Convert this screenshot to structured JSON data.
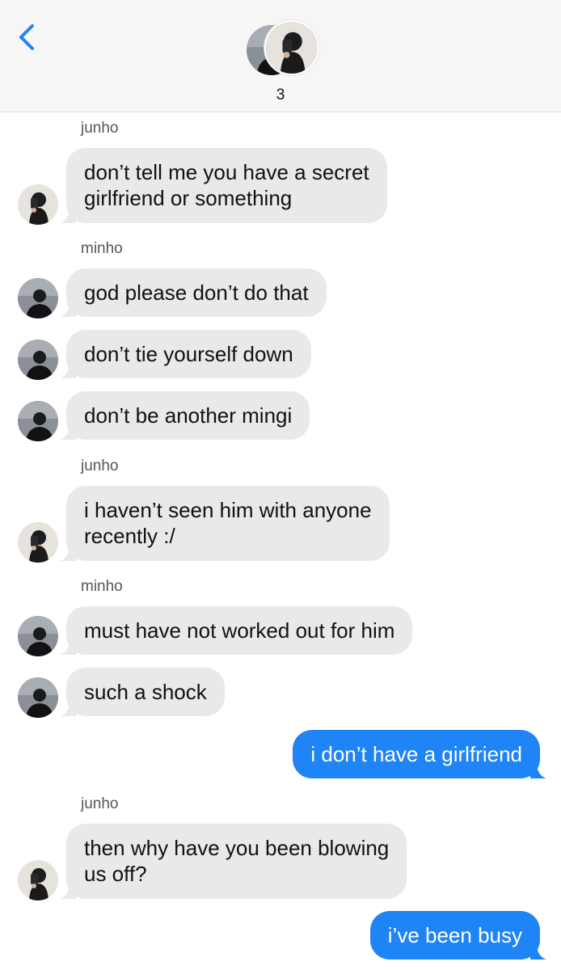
{
  "header": {
    "back_icon": "chevron-left-icon",
    "participant_count": "3",
    "accent": "#1f84f5"
  },
  "messages": [
    {
      "type": "sender",
      "text": "junho"
    },
    {
      "type": "in",
      "who": "junho",
      "text": [
        "don’t tell me you have a secret",
        "girlfriend or something"
      ]
    },
    {
      "type": "sender",
      "text": "minho"
    },
    {
      "type": "in",
      "who": "minho",
      "text": [
        "god please don’t do that"
      ]
    },
    {
      "type": "in",
      "who": "minho",
      "text": [
        "don’t tie yourself down"
      ]
    },
    {
      "type": "in",
      "who": "minho",
      "text": [
        "don’t be another mingi"
      ]
    },
    {
      "type": "sender",
      "text": "junho"
    },
    {
      "type": "in",
      "who": "junho",
      "text": [
        "i haven’t seen him with anyone",
        "recently :/"
      ]
    },
    {
      "type": "sender",
      "text": "minho"
    },
    {
      "type": "in",
      "who": "minho",
      "text": [
        "must have not worked out for him"
      ]
    },
    {
      "type": "in",
      "who": "minho",
      "text": [
        "such a shock"
      ]
    },
    {
      "type": "out",
      "text": [
        "i don’t have a girlfriend"
      ]
    },
    {
      "type": "sender",
      "text": "junho"
    },
    {
      "type": "in",
      "who": "junho",
      "text": [
        "then why have you been blowing",
        "us off?"
      ]
    },
    {
      "type": "out",
      "text": [
        "i’ve been busy"
      ]
    }
  ],
  "colors": {
    "incoming_bubble": "#e9e9eb",
    "outgoing_bubble": "#1f84f5",
    "header_bg": "#f6f6f7"
  }
}
